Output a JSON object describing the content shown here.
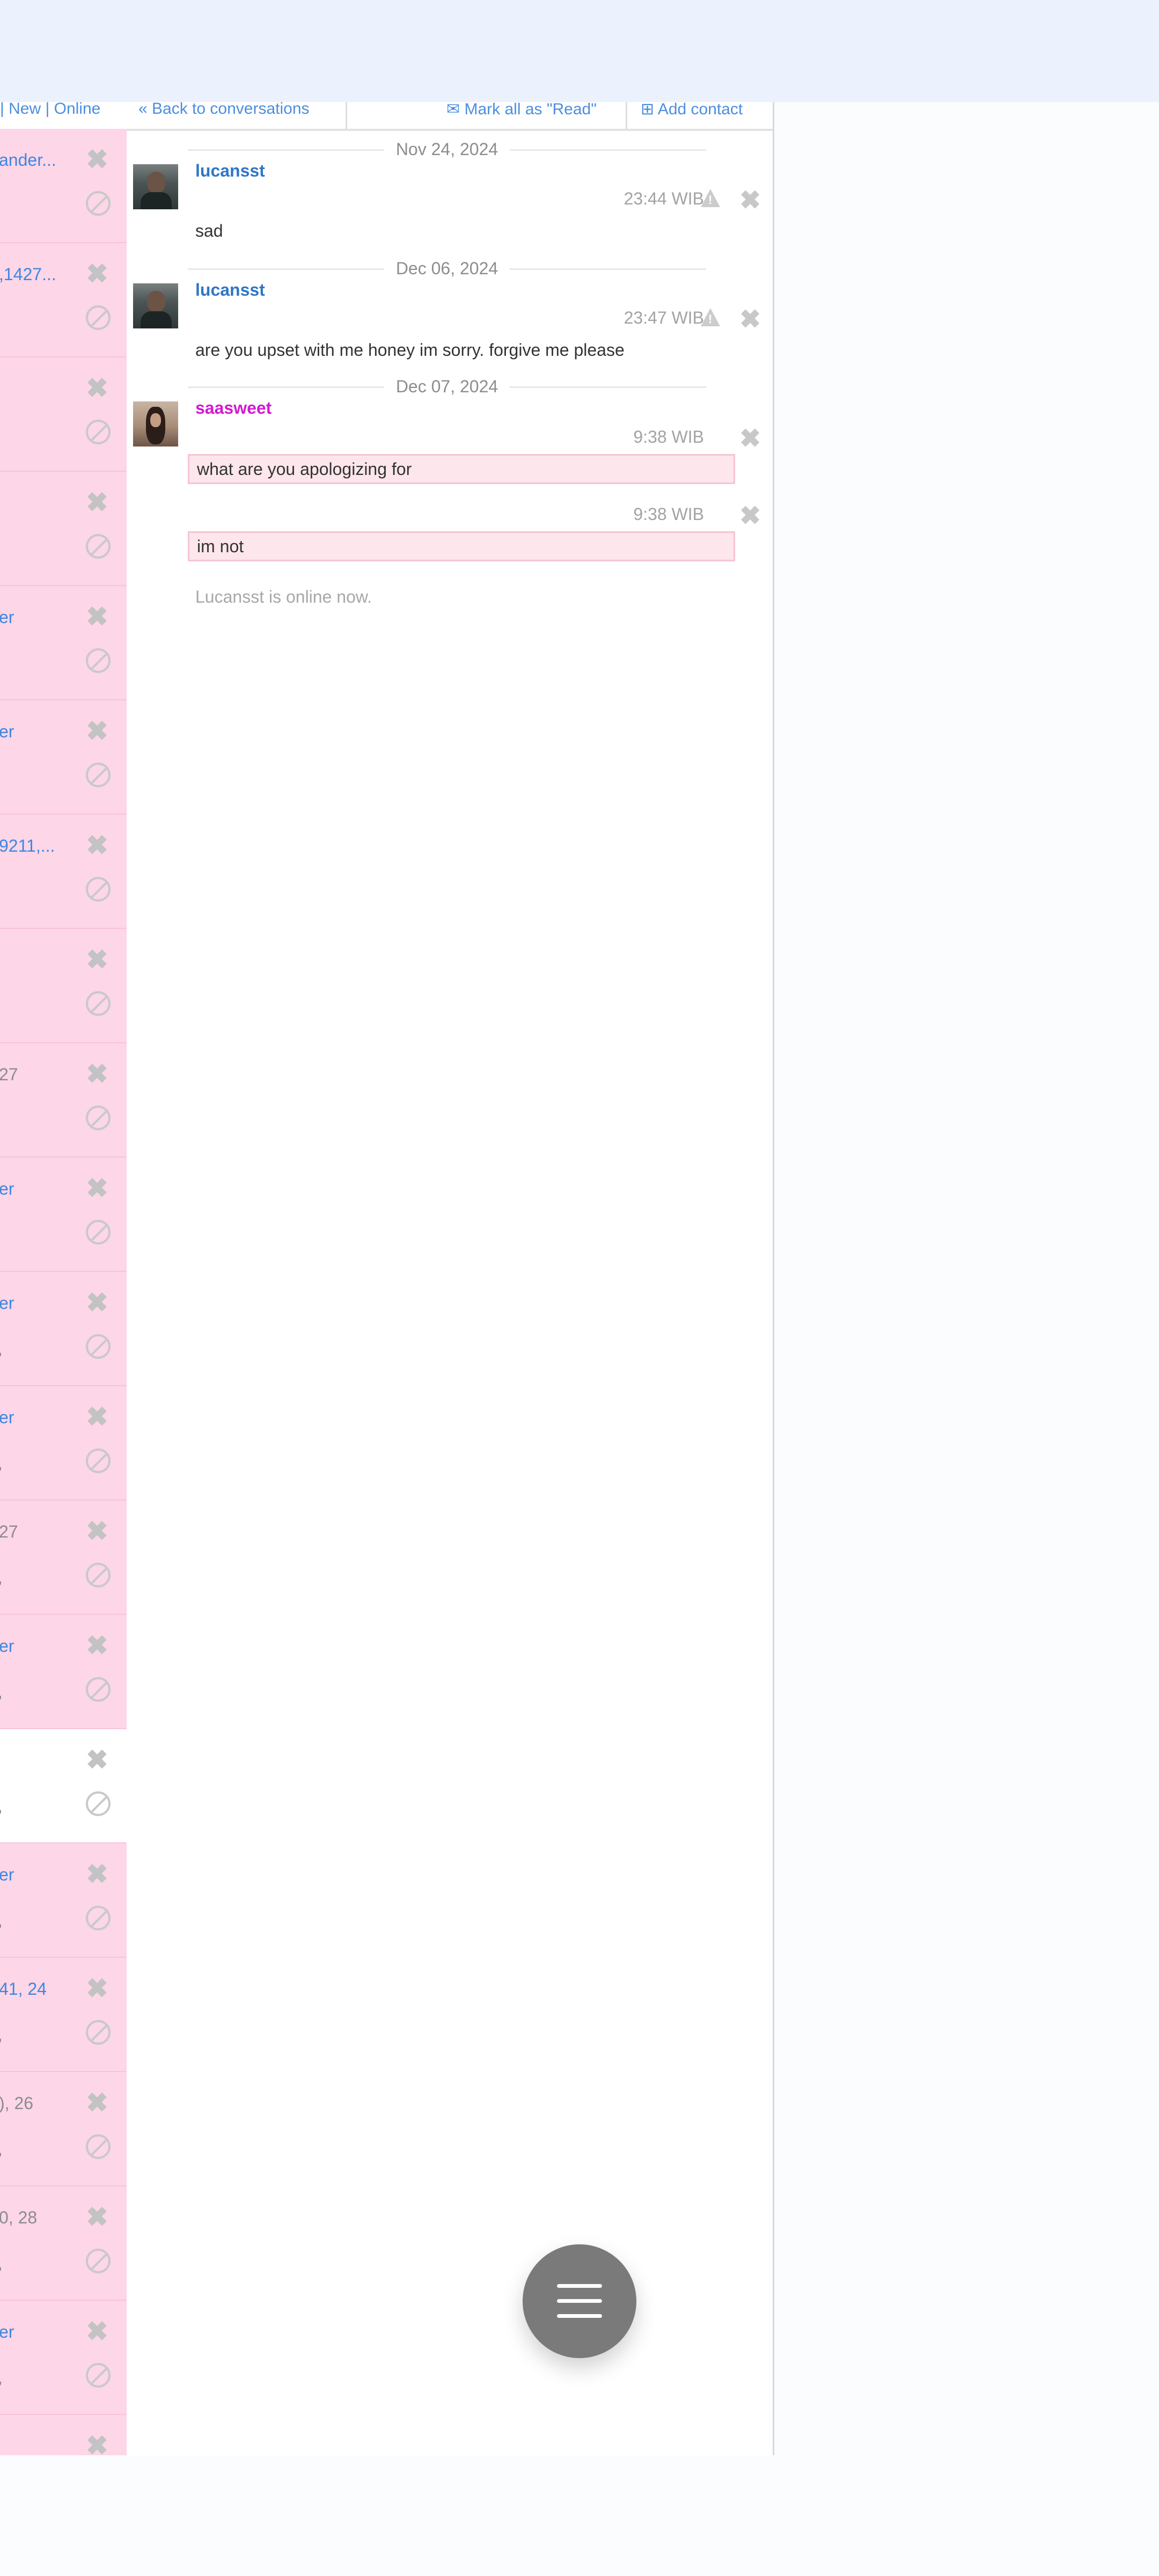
{
  "conversation_list": {
    "header_text": "| New | Online",
    "items": [
      {
        "name": "ander...",
        "name_style": "blue",
        "detail": ""
      },
      {
        "name": ",1427...",
        "name_style": "blue",
        "detail": ""
      },
      {
        "name": "",
        "name_style": "blue",
        "detail": ""
      },
      {
        "name": "",
        "name_style": "blue",
        "detail": ""
      },
      {
        "name": "er",
        "name_style": "blue",
        "detail": ""
      },
      {
        "name": "er",
        "name_style": "blue",
        "detail": ""
      },
      {
        "name": "9211,...",
        "name_style": "blue",
        "detail": ""
      },
      {
        "name": "",
        "name_style": "blue",
        "detail": ""
      },
      {
        "name": " 27",
        "name_style": "gray",
        "detail": ""
      },
      {
        "name": "er",
        "name_style": "blue",
        "detail": ""
      },
      {
        "name": "er",
        "name_style": "blue",
        "detail": ","
      },
      {
        "name": "er",
        "name_style": "blue",
        "detail": ","
      },
      {
        "name": "27",
        "name_style": "gray",
        "detail": ","
      },
      {
        "name": "er",
        "name_style": "blue",
        "detail": ","
      },
      {
        "name": "",
        "name_style": "blue",
        "detail": ","
      },
      {
        "name": "er",
        "name_style": "blue",
        "detail": ","
      },
      {
        "name": "41, 24",
        "name_style": "blue",
        "detail": ","
      },
      {
        "name": "), 26",
        "name_style": "gray",
        "detail": ","
      },
      {
        "name": "0, 28",
        "name_style": "gray",
        "detail": ","
      },
      {
        "name": "er",
        "name_style": "blue",
        "detail": ","
      },
      {
        "name": "",
        "name_style": "blue",
        "detail": ""
      }
    ]
  },
  "chat_toolbar": {
    "back_label": "Back to conversations",
    "mark_read_label": "Mark all as \"Read\"",
    "add_contact_label": "Add contact"
  },
  "chat": {
    "dates": [
      "Nov 24, 2024",
      "Dec 06, 2024",
      "Dec 07, 2024"
    ],
    "messages": [
      {
        "sender": "lucansst",
        "time": "23:44 WIB",
        "text": "sad"
      },
      {
        "sender": "lucansst",
        "time": "23:47 WIB",
        "text": "are you upset with me honey im sorry. forgive me please"
      },
      {
        "sender": "saasweet",
        "time": "9:38 WIB",
        "text": "what are you apologizing for"
      },
      {
        "sender": "",
        "time": "9:38 WIB",
        "text": "im not"
      }
    ],
    "status_text": "Lucansst is online now."
  },
  "colors": {
    "top_bar": "#ebf1fd",
    "list_item_bg": "#fdd6e8",
    "link_blue": "#4d8ede",
    "sender_blue": "#2f76c8",
    "sender_pink": "#d21ad0",
    "own_bubble": "#fde6ec",
    "fab": "#7a7a7a"
  },
  "icons": {
    "delete": "close-x-icon",
    "block": "block-icon",
    "report": "warning-icon",
    "menu": "hamburger-menu-icon"
  }
}
